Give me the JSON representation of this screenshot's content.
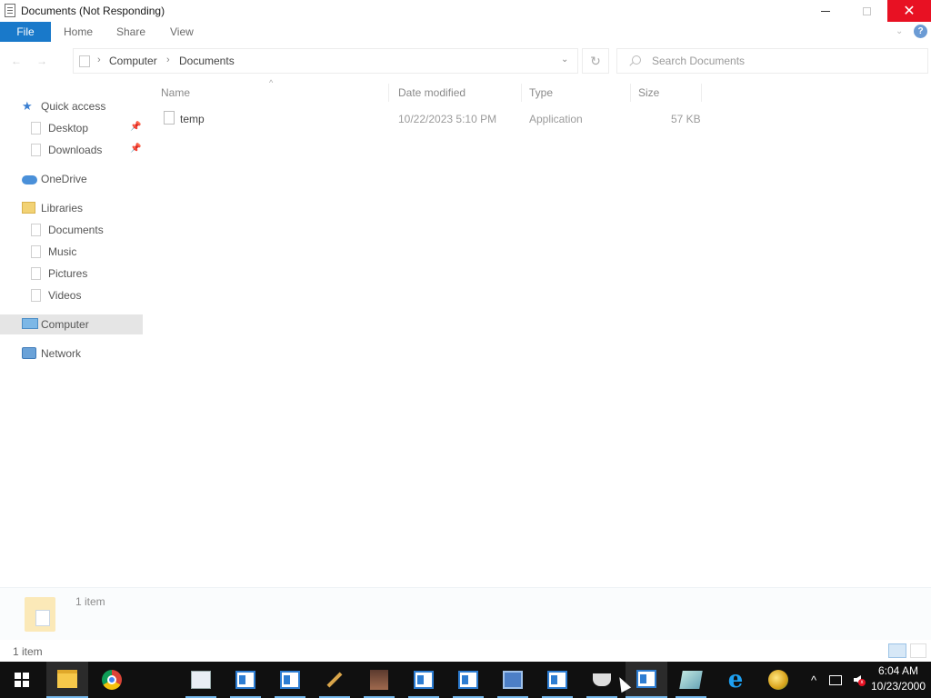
{
  "window": {
    "title": "Documents (Not Responding)"
  },
  "ribbon": {
    "tabs": [
      "File",
      "Home",
      "Share",
      "View"
    ],
    "help": "?"
  },
  "address": {
    "breadcrumb": [
      "Computer",
      "Documents"
    ],
    "separator": "›",
    "search_placeholder": "Search Documents"
  },
  "sidebar": {
    "items": [
      {
        "label": "Quick access",
        "icon": "quick-access-star-icon",
        "pinned": false
      },
      {
        "label": "Desktop",
        "icon": "desktop-icon",
        "pinned": true
      },
      {
        "label": "Downloads",
        "icon": "downloads-icon",
        "pinned": true
      },
      {
        "label": "OneDrive",
        "icon": "onedrive-cloud-icon"
      },
      {
        "label": "Libraries",
        "icon": "libraries-icon"
      },
      {
        "label": "Documents",
        "icon": "documents-icon"
      },
      {
        "label": "Music",
        "icon": "music-icon"
      },
      {
        "label": "Pictures",
        "icon": "pictures-icon"
      },
      {
        "label": "Videos",
        "icon": "videos-icon"
      },
      {
        "label": "Computer",
        "icon": "computer-icon",
        "selected": true
      },
      {
        "label": "Network",
        "icon": "network-icon"
      }
    ]
  },
  "file_list": {
    "columns": [
      "Name",
      "Date modified",
      "Type",
      "Size"
    ],
    "rows": [
      {
        "name": "temp",
        "date_modified": "10/22/2023 5:10 PM",
        "type": "Application",
        "size": "57 KB"
      }
    ]
  },
  "details_pane": {
    "count": "1 item"
  },
  "statusbar": {
    "count": "1 item"
  },
  "taskbar": {
    "clock_time": "6:04 AM",
    "clock_date": "10/23/2000",
    "apps": [
      "file-explorer",
      "chrome",
      "app-window",
      "app-window",
      "app-window",
      "pen-tool",
      "photo-app",
      "app-window",
      "app-window",
      "network-computers",
      "app-window",
      "coffee-cup",
      "app-window",
      "notepad-app",
      "internet-explorer",
      "ball-app"
    ]
  },
  "colors": {
    "accent": "#1979ca",
    "close_button": "#e81123",
    "taskbar": "#101010",
    "selected_nav": "#e5e5e5"
  }
}
